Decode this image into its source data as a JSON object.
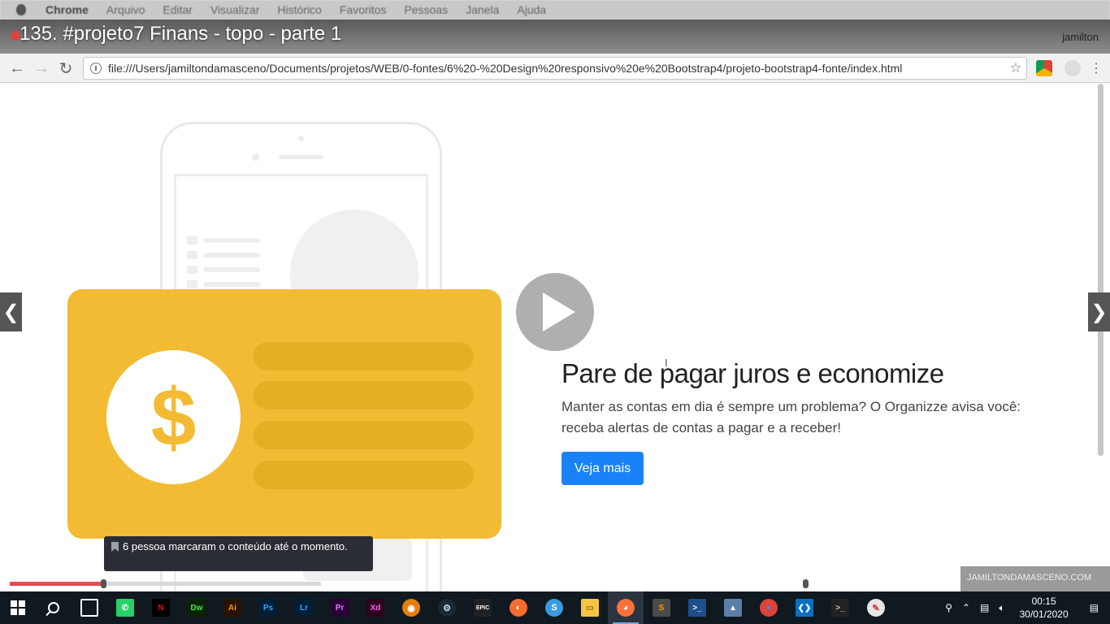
{
  "mac_menu": {
    "app": "Chrome",
    "items": [
      "Arquivo",
      "Editar",
      "Visualizar",
      "Histórico",
      "Favoritos",
      "Pessoas",
      "Janela",
      "Ajuda"
    ]
  },
  "video": {
    "title": "135. #projeto7 Finans - topo - parte 1",
    "bookmark_tooltip": "6 pessoa marcaram o conteúdo até o momento.",
    "progress_fraction": 0.3,
    "watermark": "JAMILTONDAMASCENO.COM"
  },
  "browser": {
    "profile_name": "jamilton",
    "url": "file:///Users/jamiltondamasceno/Documents/projetos/WEB/0-fontes/6%20-%20Design%20responsivo%20e%20Bootstrap4/projeto-bootstrap4-fonte/index.html"
  },
  "page": {
    "headline": "Pare de pagar juros e economize",
    "description": "Manter as contas em dia é sempre um problema? O Organizze avisa você: receba alertas de contas a pagar e a receber!",
    "cta_label": "Veja mais",
    "coin_symbol": "$"
  },
  "taskbar": {
    "apps": [
      {
        "name": "store-icon",
        "label": "",
        "bg": "#0078d7",
        "color": "#fff",
        "shape": "sq"
      },
      {
        "name": "whatsapp-icon",
        "label": "✆",
        "bg": "#25d366",
        "color": "#fff",
        "shape": "sq"
      },
      {
        "name": "netflix-icon",
        "label": "N",
        "bg": "#000",
        "color": "#e50914",
        "shape": "sq"
      },
      {
        "name": "dreamweaver-icon",
        "label": "Dw",
        "bg": "#072401",
        "color": "#4be14b",
        "shape": "sq"
      },
      {
        "name": "illustrator-icon",
        "label": "Ai",
        "bg": "#2a1200",
        "color": "#ff9a00",
        "shape": "sq"
      },
      {
        "name": "photoshop-icon",
        "label": "Ps",
        "bg": "#001e36",
        "color": "#31a8ff",
        "shape": "sq"
      },
      {
        "name": "lightroom-icon",
        "label": "Lr",
        "bg": "#001e36",
        "color": "#31a8ff",
        "shape": "sq"
      },
      {
        "name": "premiere-icon",
        "label": "Pr",
        "bg": "#2a0038",
        "color": "#e77cff",
        "shape": "sq"
      },
      {
        "name": "xd-icon",
        "label": "Xd",
        "bg": "#2e001e",
        "color": "#ff61f6",
        "shape": "sq"
      },
      {
        "name": "blender-icon",
        "label": "◉",
        "bg": "#e87d0d",
        "color": "#fff",
        "shape": "rd"
      },
      {
        "name": "steam-icon",
        "label": "⚙",
        "bg": "#1b2838",
        "color": "#c7d5e0",
        "shape": "rd"
      },
      {
        "name": "epic-games-icon",
        "label": "EPIC",
        "bg": "#222",
        "color": "#fff",
        "shape": "sq"
      },
      {
        "name": "origin-icon",
        "label": "◐",
        "bg": "#f56c2d",
        "color": "#fff",
        "shape": "rd"
      },
      {
        "name": "simplenote-icon",
        "label": "S",
        "bg": "#3a9be0",
        "color": "#fff",
        "shape": "rd"
      },
      {
        "name": "file-explorer-icon",
        "label": "▭",
        "bg": "#f4c542",
        "color": "#8a6d0b",
        "shape": "sq"
      },
      {
        "name": "firefox-icon",
        "label": "◕",
        "bg": "#ff7139",
        "color": "#fff",
        "shape": "rd",
        "active": true
      },
      {
        "name": "sublime-icon",
        "label": "S",
        "bg": "#4b4b4b",
        "color": "#ff9800",
        "shape": "sq"
      },
      {
        "name": "powershell-icon",
        "label": ">_",
        "bg": "#1f4e8c",
        "color": "#fff",
        "shape": "sq"
      },
      {
        "name": "monitor-icon",
        "label": "▲",
        "bg": "#5a7fa8",
        "color": "#fff",
        "shape": "sq"
      },
      {
        "name": "chrome-icon",
        "label": "●",
        "bg": "#db4437",
        "color": "#4285f4",
        "shape": "rd"
      },
      {
        "name": "vscode-icon",
        "label": "❮❯",
        "bg": "#0a6fc2",
        "color": "#fff",
        "shape": "sq"
      },
      {
        "name": "terminal-icon",
        "label": ">_",
        "bg": "#222",
        "color": "#ccc",
        "shape": "sq"
      },
      {
        "name": "paint-icon",
        "label": "✎",
        "bg": "#e6e6e6",
        "color": "#d33",
        "shape": "rd"
      }
    ],
    "time": "00:15",
    "date": "30/01/2020"
  }
}
